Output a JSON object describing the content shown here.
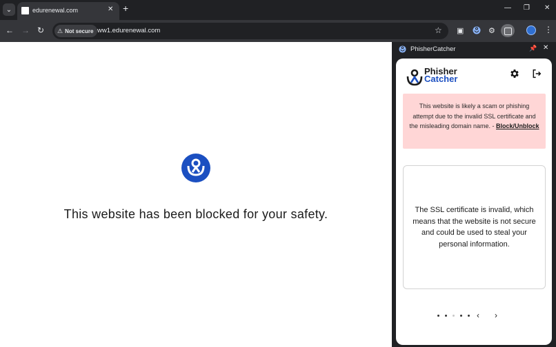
{
  "browser": {
    "tab_title": "edurenewal.com",
    "url": "ww1.edurenewal.com",
    "security_chip": "Not secure"
  },
  "page": {
    "blocked_message": "This website has been blocked for your safety."
  },
  "side_panel": {
    "title": "PhisherCatcher",
    "brand_line1": "Phisher",
    "brand_line2": "Catcher",
    "alert_text": "This website is likely a scam or phishing attempt due to the invalid SSL certificate and the misleading domain name. - ",
    "alert_link": "Block/Unblock",
    "info_text": "The SSL certificate is invalid, which means that the website is not secure and could be used to steal your personal information.",
    "pager": {
      "total": 5,
      "active_index": 2
    }
  },
  "colors": {
    "brand_blue": "#1b4fc1",
    "alert_bg": "#ffd6d6",
    "browser_dark": "#202124"
  },
  "icons": [
    "tab-search-icon",
    "close-icon",
    "plus-icon",
    "minimize-icon",
    "restore-icon",
    "back-icon",
    "forward-icon",
    "reload-icon",
    "warning-icon",
    "star-icon",
    "pip-icon",
    "phishercatcher-icon",
    "extensions-icon",
    "side-panel-icon",
    "profile-icon",
    "menu-icon",
    "pin-icon",
    "gear-icon",
    "logout-icon",
    "chevron-left-icon",
    "chevron-right-icon"
  ]
}
